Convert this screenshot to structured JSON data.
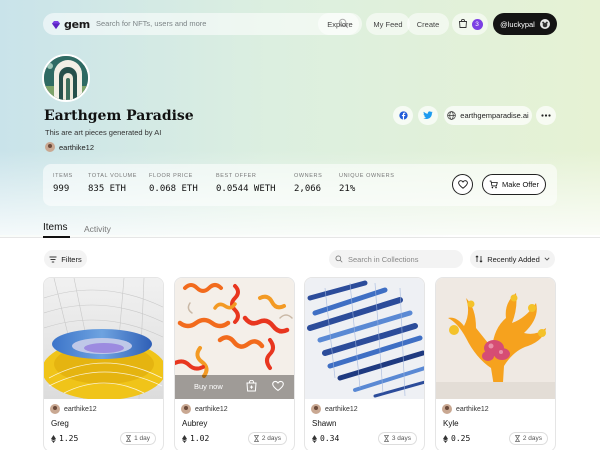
{
  "brand": {
    "name": "gem",
    "accent": "#7b3fe4"
  },
  "nav": {
    "search_placeholder": "Search for NFTs, users and more",
    "explore": "Explore",
    "my_feed": "My Feed",
    "create": "Create",
    "cart_count": "3",
    "account": "@luckypal"
  },
  "collection": {
    "title": "Earthgem Paradise",
    "description": "This are art pieces generated by AI",
    "creator": "earthike12",
    "website": "earthgemparadise.ai",
    "stats": [
      {
        "label": "Items",
        "value": "999"
      },
      {
        "label": "Total Volume",
        "value": "835 ETH"
      },
      {
        "label": "Floor Price",
        "value": "0.068 ETH"
      },
      {
        "label": "Best Offer",
        "value": "0.0544 WETH"
      },
      {
        "label": "Owners",
        "value": "2,066"
      },
      {
        "label": "Unique Owners",
        "value": "21%"
      }
    ],
    "make_offer": "Make Offer"
  },
  "tabs": {
    "items": "Items",
    "activity": "Activity"
  },
  "toolbar": {
    "filters": "Filters",
    "search_placeholder": "Search in Collections",
    "sort": "Recently Added"
  },
  "cards": [
    {
      "owner": "earthike12",
      "name": "Greg",
      "price": "1.25",
      "time": "1 day",
      "icon": "abstract-rings-art"
    },
    {
      "owner": "earthike12",
      "name": "Aubrey",
      "price": "1.02",
      "time": "2 days",
      "icon": "orange-spirals-art",
      "buy_now": "Buy now"
    },
    {
      "owner": "earthike12",
      "name": "Shawn",
      "price": "0.34",
      "time": "3 days",
      "icon": "blue-feathers-art"
    },
    {
      "owner": "earthike12",
      "name": "Kyle",
      "price": "0.25",
      "time": "2 days",
      "icon": "coral-sculpture-art"
    }
  ]
}
